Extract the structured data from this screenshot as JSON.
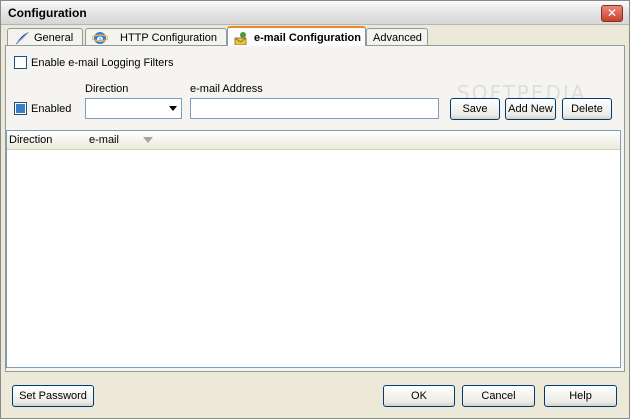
{
  "window": {
    "title": "Configuration",
    "close_label": "✕"
  },
  "tabs": [
    {
      "label": "General",
      "icon": "feather-icon"
    },
    {
      "label": "HTTP Configuration",
      "icon": "ie-globe-icon"
    },
    {
      "label": "e-mail Configuration",
      "icon": "mail-person-icon",
      "active": true
    },
    {
      "label": "Advanced",
      "icon": ""
    }
  ],
  "email": {
    "enable_filters_label": "Enable e-mail Logging Filters",
    "enable_filters_checked": false,
    "enabled_label": "Enabled",
    "enabled_checked": true,
    "direction_label": "Direction",
    "direction_value": "",
    "address_label": "e-mail Address",
    "address_value": "",
    "save_label": "Save",
    "add_new_label": "Add New",
    "delete_label": "Delete"
  },
  "list": {
    "columns": [
      "Direction",
      "e-mail"
    ],
    "rows": []
  },
  "footer": {
    "set_password_label": "Set Password",
    "ok_label": "OK",
    "cancel_label": "Cancel",
    "help_label": "Help"
  },
  "watermark": "SOFTPEDIA"
}
